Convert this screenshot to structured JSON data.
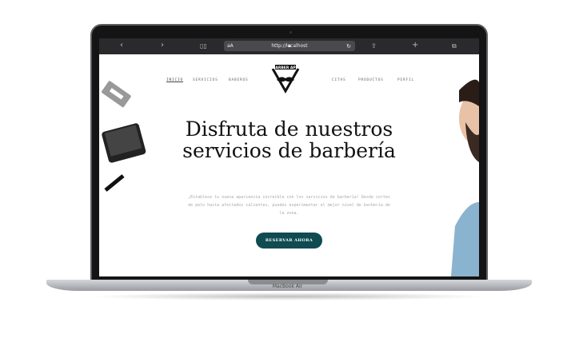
{
  "device": {
    "label": "MacBook Air"
  },
  "browser": {
    "url": "http://localhost",
    "text_size": "aA",
    "icons": [
      "chevron-left",
      "chevron-right",
      "book",
      "lock",
      "reload",
      "share",
      "plus",
      "tabs"
    ]
  },
  "site": {
    "nav_left": [
      "INICIO",
      "SERVICIOS",
      "BABEROS"
    ],
    "nav_right": [
      "CITAS",
      "PRODUCTOS",
      "PERFIL"
    ],
    "logo_text": "BARBER APP",
    "headline": "Disfruta de nuestros servicios de barbería",
    "description": "¡Establece tu nueva apariencia increíble con los servicios de barbería! Desde cortes de pelo hasta afeitados calientes, puedes experimentar el mejor nivel de barbería de la zona.",
    "cta": "RESERVAR AHORA",
    "accent": "#0f4b51"
  }
}
